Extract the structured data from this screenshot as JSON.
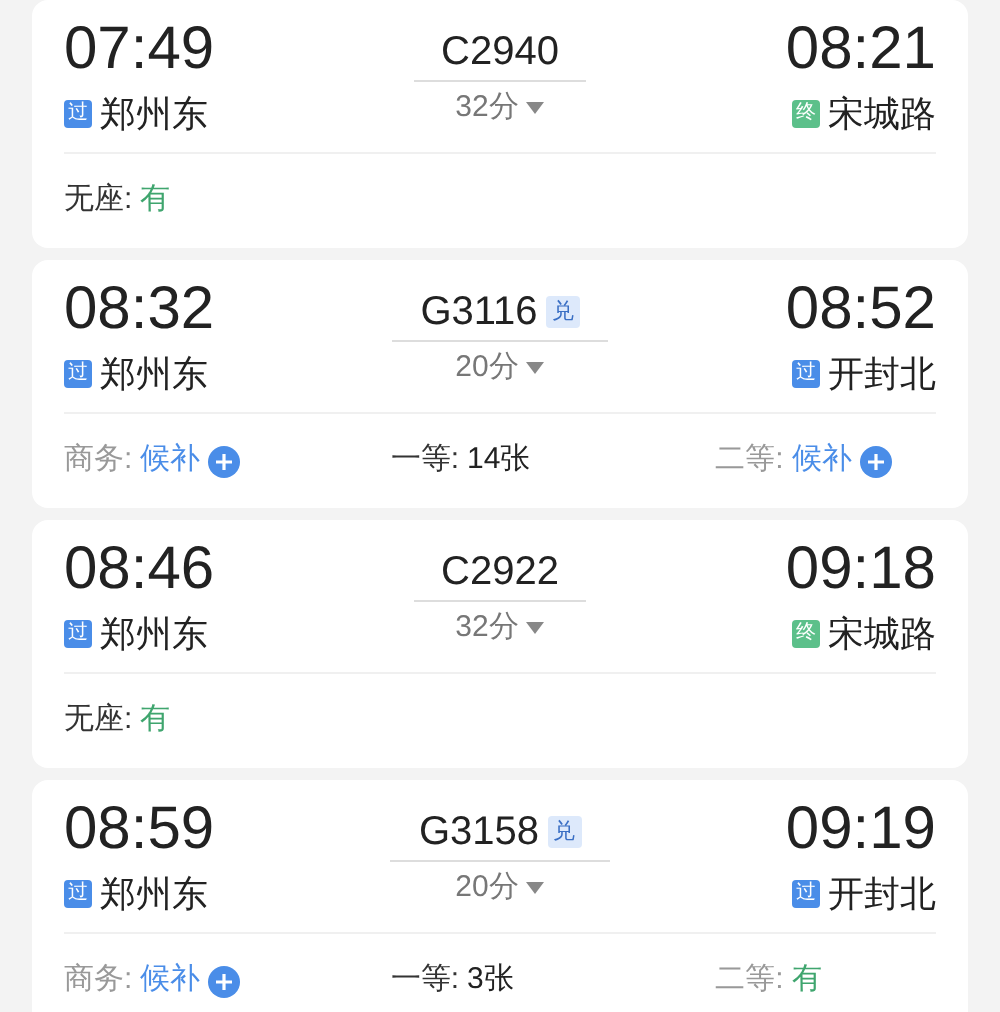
{
  "trains": [
    {
      "depart_time": "07:49",
      "from": {
        "badge": "过",
        "kind": "pass",
        "name": "郑州东"
      },
      "number": "C2940",
      "duration": "32分",
      "arrive_time": "08:21",
      "to": {
        "badge": "终",
        "kind": "end",
        "name": "宋城路"
      },
      "seats": [
        {
          "label": "无座:",
          "value": "有",
          "kind": "plenty",
          "dimmed": false
        }
      ]
    },
    {
      "depart_time": "08:32",
      "from": {
        "badge": "过",
        "kind": "pass",
        "name": "郑州东"
      },
      "number": "G3116",
      "tag": "兑",
      "duration": "20分",
      "arrive_time": "08:52",
      "to": {
        "badge": "过",
        "kind": "pass",
        "name": "开封北"
      },
      "seats": [
        {
          "label": "商务:",
          "value": "候补",
          "kind": "waitlist",
          "dimmed": true
        },
        {
          "label": "一等:",
          "value": "14张",
          "kind": "count",
          "dimmed": false
        },
        {
          "label": "二等:",
          "value": "候补",
          "kind": "waitlist",
          "dimmed": true
        }
      ]
    },
    {
      "depart_time": "08:46",
      "from": {
        "badge": "过",
        "kind": "pass",
        "name": "郑州东"
      },
      "number": "C2922",
      "duration": "32分",
      "arrive_time": "09:18",
      "to": {
        "badge": "终",
        "kind": "end",
        "name": "宋城路"
      },
      "seats": [
        {
          "label": "无座:",
          "value": "有",
          "kind": "plenty",
          "dimmed": false
        }
      ]
    },
    {
      "depart_time": "08:59",
      "from": {
        "badge": "过",
        "kind": "pass",
        "name": "郑州东"
      },
      "number": "G3158",
      "tag": "兑",
      "duration": "20分",
      "arrive_time": "09:19",
      "to": {
        "badge": "过",
        "kind": "pass",
        "name": "开封北"
      },
      "seats": [
        {
          "label": "商务:",
          "value": "候补",
          "kind": "waitlist",
          "dimmed": true
        },
        {
          "label": "一等:",
          "value": "3张",
          "kind": "count",
          "dimmed": false
        },
        {
          "label": "二等:",
          "value": "有",
          "kind": "plenty",
          "dimmed": true
        }
      ]
    }
  ]
}
